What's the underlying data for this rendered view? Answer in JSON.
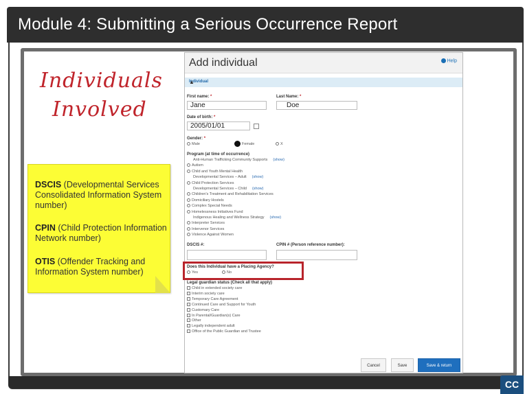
{
  "slide": {
    "title": "Module 4:  Submitting a Serious Occurrence Report",
    "handwritten_line1": "Individuals",
    "handwritten_line2": "Involved",
    "cc_label": "CC"
  },
  "note": {
    "items": [
      {
        "term": "DSCIS",
        "desc": " (Developmental Services Consolidated Information System number)"
      },
      {
        "term": "CPIN",
        "desc": " (Child Protection Information Network number)"
      },
      {
        "term": "OTIS",
        "desc": " (Offender Tracking and Information System number)"
      }
    ]
  },
  "form": {
    "title": "Add individual",
    "help": "Help",
    "section": "Individual",
    "first_name_label": "First name:",
    "first_name_value": "Jane",
    "last_name_label": "Last Name:",
    "last_name_value": "Doe",
    "dob_label": "Date of birth:",
    "dob_value": "2005/01/01",
    "required_mark": "*",
    "gender_label": "Gender:",
    "gender_options": [
      "Male",
      "Female",
      "X"
    ],
    "program_label": "Program (at time of occurrence)",
    "programs": [
      {
        "label": "Anti-Human Trafficking Community Supports",
        "show": "(show)",
        "indent": true,
        "radio": false
      },
      {
        "label": "Autism",
        "show": "",
        "indent": false,
        "radio": true
      },
      {
        "label": "Child and Youth Mental Health",
        "show": "",
        "indent": false,
        "radio": true
      },
      {
        "label": "Developmental Services – Adult",
        "show": "(show)",
        "indent": true,
        "radio": false
      },
      {
        "label": "Child Protection Services",
        "show": "",
        "indent": false,
        "radio": true
      },
      {
        "label": "Developmental Services – Child",
        "show": "(show)",
        "indent": true,
        "radio": false
      },
      {
        "label": "Children's Treatment and Rehabilitation Services",
        "show": "",
        "indent": false,
        "radio": true
      },
      {
        "label": "Domiciliary Hostels",
        "show": "",
        "indent": false,
        "radio": true
      },
      {
        "label": "Complex Special Needs",
        "show": "",
        "indent": false,
        "radio": true
      },
      {
        "label": "Homelessness Initiatives Fund",
        "show": "",
        "indent": false,
        "radio": true
      },
      {
        "label": "Indigenous Healing and Wellness Strategy",
        "show": "(show)",
        "indent": true,
        "radio": false
      },
      {
        "label": "Interpreter Services",
        "show": "",
        "indent": false,
        "radio": true
      },
      {
        "label": "Intervenor Services",
        "show": "",
        "indent": false,
        "radio": true
      },
      {
        "label": "Violence Against Women",
        "show": "",
        "indent": false,
        "radio": true
      }
    ],
    "dscis_label": "DSCIS #:",
    "cpin_label": "CPIN # (Person reference number):",
    "placing_question": "Does this Individual have a Placing Agency?",
    "placing_options": [
      "Yes",
      "No"
    ],
    "guardian_label": "Legal guardian status (Check all that apply)",
    "guardian_options": [
      "Child in extended society care",
      "Interim society care",
      "Temporary Care Agreement",
      "Continued Care and Support for Youth",
      "Customary Care",
      "In Parental/Guardian(s) Care",
      "Other",
      "Legally independent adult",
      "Office of the Public Guardian and Trustee"
    ],
    "buttons": {
      "cancel": "Cancel",
      "save": "Save",
      "save_return": "Save & return"
    }
  }
}
